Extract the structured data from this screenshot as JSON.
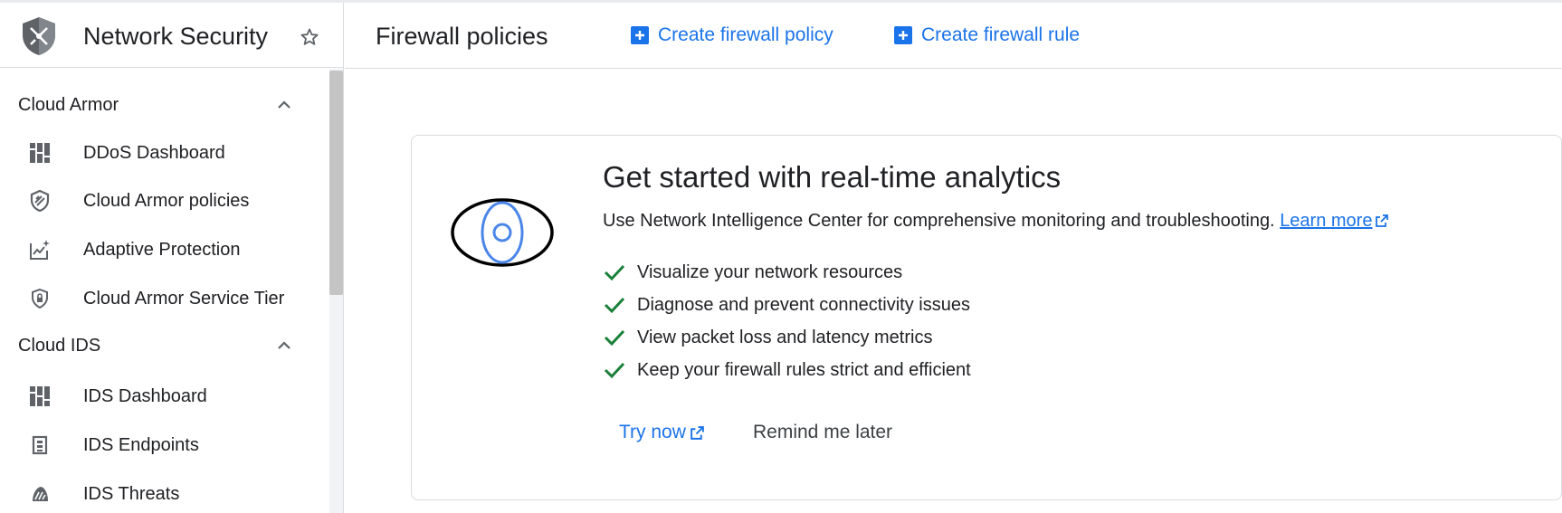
{
  "app": {
    "product_title": "Network Security",
    "page_title": "Firewall policies",
    "accent_color": "#1a73e8"
  },
  "header_actions": {
    "create_policy": "Create firewall policy",
    "create_rule": "Create firewall rule"
  },
  "sidebar": {
    "sections": [
      {
        "label": "Cloud Armor",
        "expanded": true,
        "items": [
          {
            "label": "DDoS Dashboard",
            "icon": "dashboard-icon"
          },
          {
            "label": "Cloud Armor policies",
            "icon": "shield-policy-icon"
          },
          {
            "label": "Adaptive Protection",
            "icon": "insights-chart-icon"
          },
          {
            "label": "Cloud Armor Service Tier",
            "icon": "shield-lock-icon"
          }
        ]
      },
      {
        "label": "Cloud IDS",
        "expanded": true,
        "items": [
          {
            "label": "IDS Dashboard",
            "icon": "dashboard-icon"
          },
          {
            "label": "IDS Endpoints",
            "icon": "endpoint-icon"
          },
          {
            "label": "IDS Threats",
            "icon": "threat-icon"
          }
        ]
      }
    ]
  },
  "promo": {
    "title": "Get started with real-time analytics",
    "description": "Use Network Intelligence Center for comprehensive monitoring and troubleshooting.",
    "learn_more": "Learn more",
    "bullets": [
      "Visualize your network resources",
      "Diagnose and prevent connectivity issues",
      "View packet loss and latency metrics",
      "Keep your firewall rules strict and efficient"
    ],
    "try_now": "Try now",
    "remind_later": "Remind me later",
    "check_color": "#188038"
  }
}
